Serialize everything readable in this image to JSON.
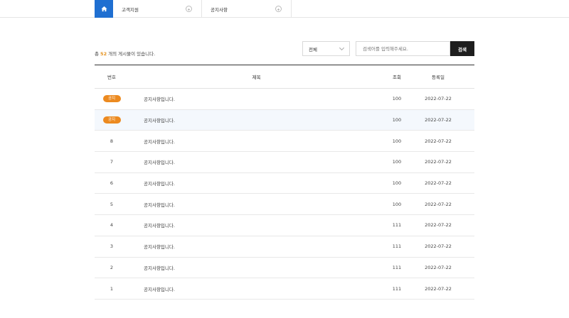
{
  "nav": {
    "home_icon": "home-icon",
    "items": [
      {
        "label": "고객지원"
      },
      {
        "label": "공지사항"
      }
    ]
  },
  "toolbar": {
    "count_prefix": "총 ",
    "count": "52",
    "count_suffix": " 개의 게시물이 있습니다.",
    "select_value": "전체",
    "search_placeholder": "검색어를 입력해주세요.",
    "search_button": "검색"
  },
  "table": {
    "headers": {
      "num": "번호",
      "title": "제목",
      "views": "조회",
      "date": "등록일"
    },
    "rows": [
      {
        "num": "공지",
        "title": "공지사항입니다.",
        "views": "100",
        "date": "2022-07-22"
      },
      {
        "num": "공지",
        "title": "공지사항입니다.",
        "views": "100",
        "date": "2022-07-22"
      },
      {
        "num": "8",
        "title": "공지사항입니다.",
        "views": "100",
        "date": "2022-07-22"
      },
      {
        "num": "7",
        "title": "공지사항입니다.",
        "views": "100",
        "date": "2022-07-22"
      },
      {
        "num": "6",
        "title": "공지사항입니다.",
        "views": "100",
        "date": "2022-07-22"
      },
      {
        "num": "5",
        "title": "공지사항입니다.",
        "views": "100",
        "date": "2022-07-22"
      },
      {
        "num": "4",
        "title": "공지사항입니다.",
        "views": "111",
        "date": "2022-07-22"
      },
      {
        "num": "3",
        "title": "공지사항입니다.",
        "views": "111",
        "date": "2022-07-22"
      },
      {
        "num": "2",
        "title": "공지사항입니다.",
        "views": "111",
        "date": "2022-07-22"
      },
      {
        "num": "1",
        "title": "공지사항입니다.",
        "views": "111",
        "date": "2022-07-22"
      }
    ]
  },
  "colors": {
    "accent": "#1f6fd1",
    "badge": "#ec8a20",
    "count": "#e5921f",
    "button": "#1e1e1e"
  }
}
